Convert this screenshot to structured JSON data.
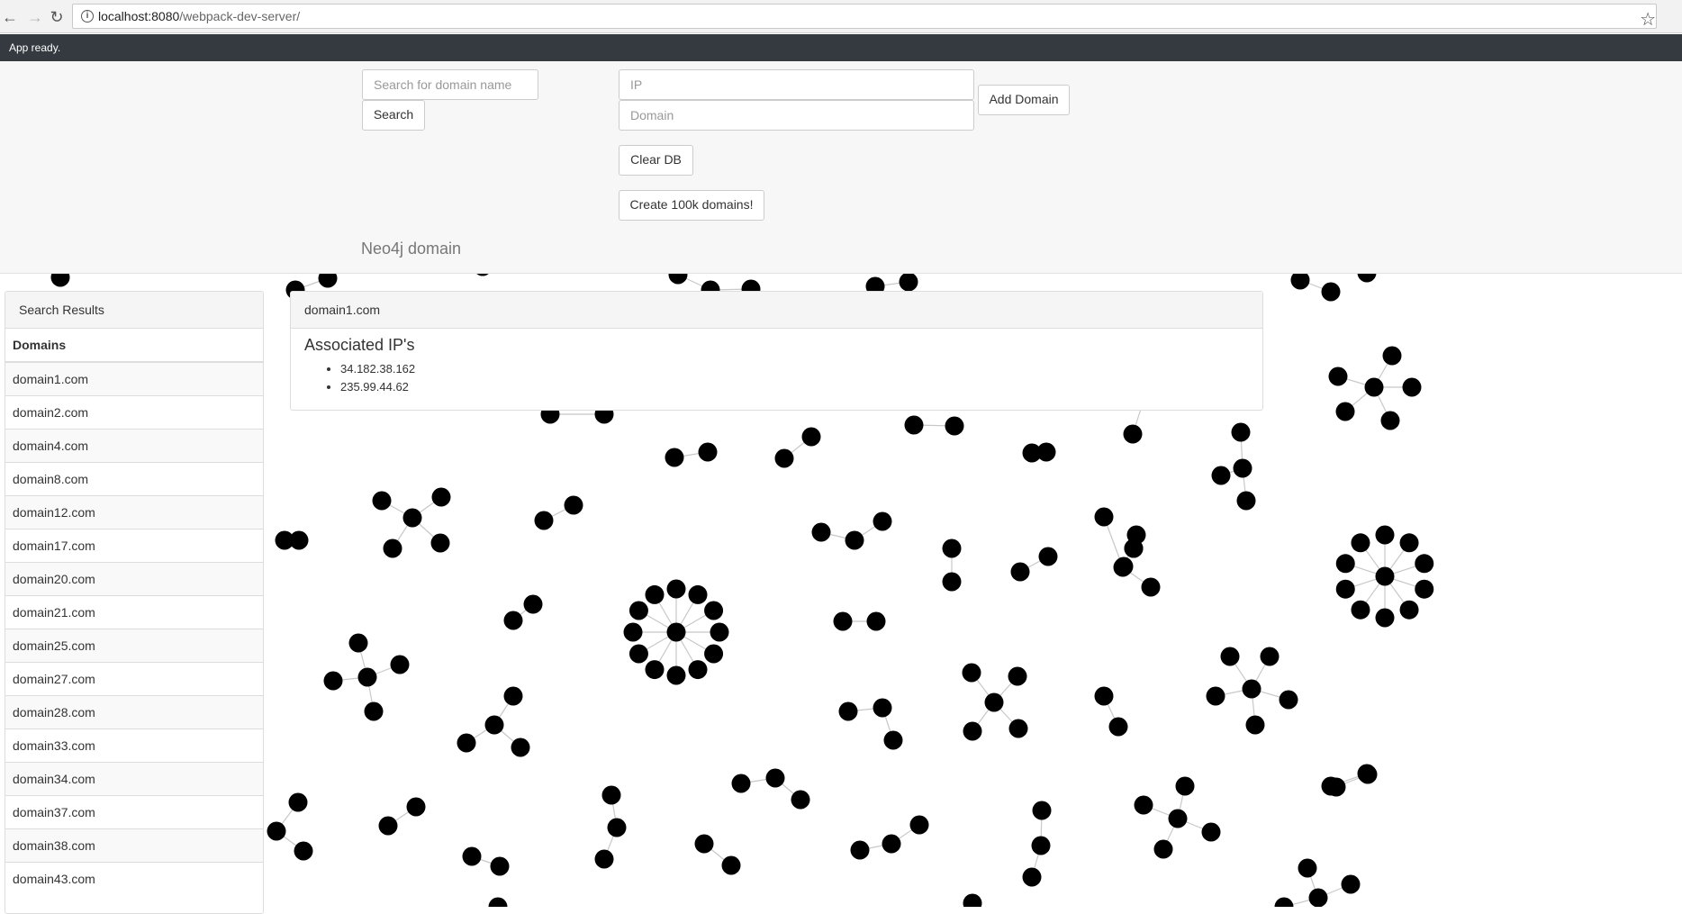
{
  "browser": {
    "url_host": "localhost:8080",
    "url_path": "/webpack-dev-server/",
    "back_icon": "arrow-left-icon",
    "forward_icon": "arrow-right-icon",
    "reload_icon": "reload-icon",
    "info_icon": "info-icon",
    "star_icon": "star-icon"
  },
  "status": {
    "text": "App ready."
  },
  "header": {
    "search_placeholder": "Search for domain name",
    "search_label": "Search",
    "ip_placeholder": "IP",
    "domain_placeholder": "Domain",
    "add_domain_label": "Add Domain",
    "clear_db_label": "Clear DB",
    "create_label": "Create 100k domains!",
    "brand": "Neo4j domain"
  },
  "results": {
    "heading": "Search Results",
    "column": "Domains",
    "items": [
      "domain1.com",
      "domain2.com",
      "domain4.com",
      "domain8.com",
      "domain12.com",
      "domain17.com",
      "domain20.com",
      "domain21.com",
      "domain25.com",
      "domain27.com",
      "domain28.com",
      "domain33.com",
      "domain34.com",
      "domain37.com",
      "domain38.com",
      "domain43.com"
    ]
  },
  "detail": {
    "domain": "domain1.com",
    "title": "Associated IP's",
    "ips": [
      "34.182.38.162",
      "235.99.44.62"
    ]
  },
  "colors": {
    "status_bar": "#343a40",
    "node": "#000000",
    "edge": "#cccccc"
  }
}
